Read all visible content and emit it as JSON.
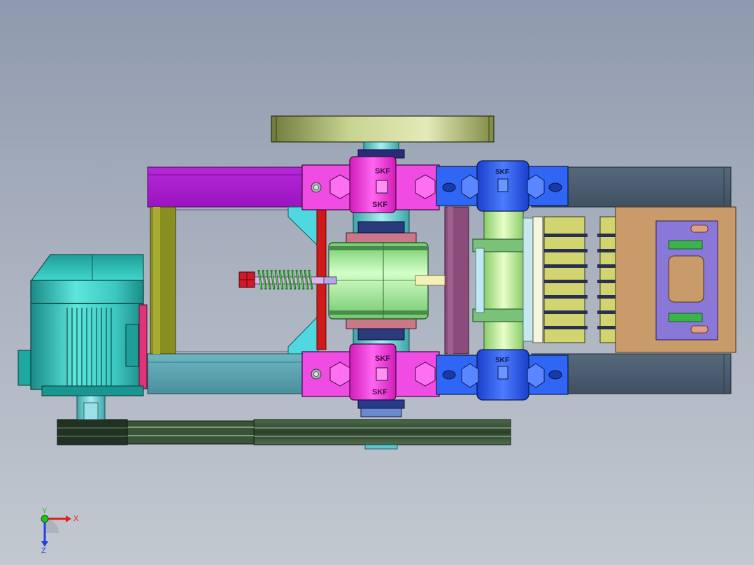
{
  "viewport": {
    "background_top": "#8f9aae",
    "background_bottom": "#c3c8d0"
  },
  "parts": {
    "housing_label": "SKF"
  },
  "axis_triad": {
    "x_label": "X",
    "y_label": "Y",
    "z_label": "Z",
    "x_color": "#e02020",
    "y_color": "#20c020",
    "z_color": "#2040e0"
  },
  "colors": {
    "bearing_housing": "#ff2ee0",
    "pillow_block": "#2d5ff0",
    "motor": "#2fc8c0",
    "flywheel": "#c2d07a",
    "frame_purple": "#a81ccc",
    "frame_slate": "#4a5d6e",
    "frame_teal": "#5aa6b4",
    "jaw_olive": "#cfcf6a",
    "drum_green": "#a8f0a0",
    "spring_green": "#2fa02f"
  }
}
